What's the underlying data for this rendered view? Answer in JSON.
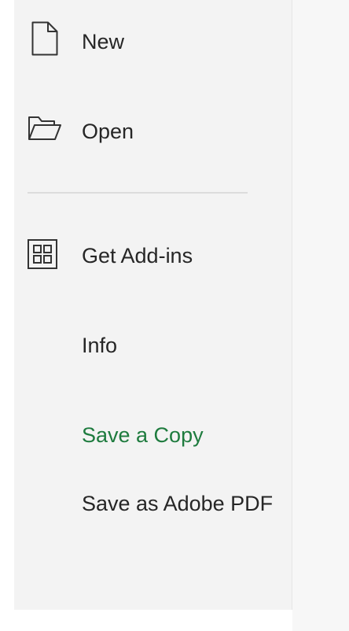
{
  "menu": {
    "new_label": "New",
    "open_label": "Open",
    "addins_label": "Get Add-ins",
    "info_label": "Info",
    "save_copy_label": "Save a Copy",
    "save_pdf_label": "Save as Adobe PDF"
  },
  "icons": {
    "new": "new-document-icon",
    "open": "folder-open-icon",
    "addins": "add-ins-grid-icon"
  },
  "colors": {
    "menu_background": "#f3f3f3",
    "text": "#262626",
    "highlight_text": "#1e7b3e",
    "divider": "#dcdcdc"
  }
}
